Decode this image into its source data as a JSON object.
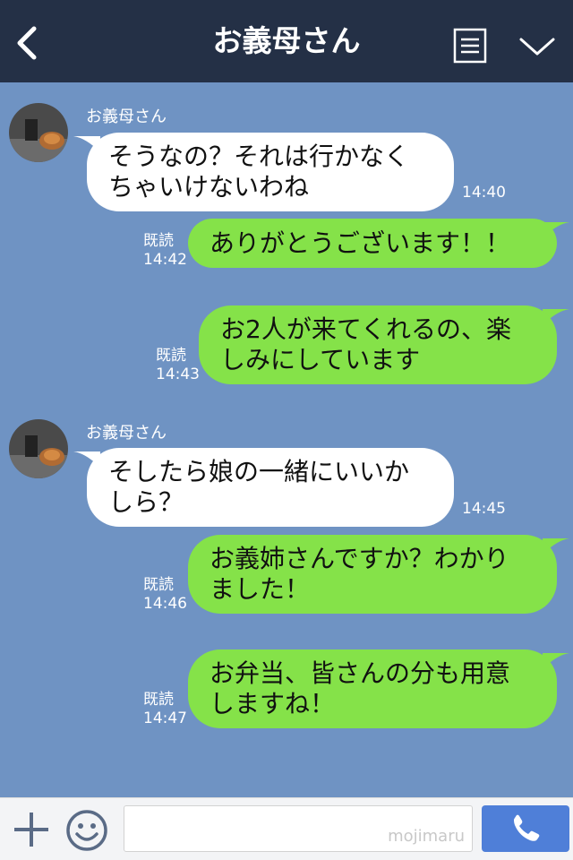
{
  "header": {
    "title": "お義母さん",
    "back_icon": "chevron-left-icon",
    "menu_icon": "menu-icon",
    "collapse_icon": "chevron-down-icon"
  },
  "colors": {
    "header_bg": "#243046",
    "chat_bg": "#6f93c3",
    "incoming_bubble": "#ffffff",
    "outgoing_bubble": "#85e249",
    "call_button": "#4f7fd8"
  },
  "messages": [
    {
      "direction": "in",
      "sender": "お義母さん",
      "lines": [
        "そうなの？それは行かなく",
        "ちゃいけないわね"
      ],
      "time": "14:40"
    },
    {
      "direction": "out",
      "read": "既読",
      "time": "14:42",
      "lines": [
        "ありがとうございます！！"
      ]
    },
    {
      "direction": "out",
      "read": "既読",
      "time": "14:43",
      "lines": [
        "お2人が来てくれるの、楽",
        "しみにしています"
      ]
    },
    {
      "direction": "in",
      "sender": "お義母さん",
      "lines": [
        "そしたら娘の一緒にいいか",
        "しら？"
      ],
      "time": "14:45"
    },
    {
      "direction": "out",
      "read": "既読",
      "time": "14:46",
      "lines": [
        "お義姉さんですか？わかり",
        "ました！"
      ]
    },
    {
      "direction": "out",
      "read": "既読",
      "time": "14:47",
      "lines": [
        "お弁当、皆さんの分も用意",
        "しますね！"
      ]
    }
  ],
  "footer": {
    "plus_icon": "plus-icon",
    "emoji_icon": "smiley-icon",
    "input_value": "",
    "watermark": "mojimaru",
    "call_icon": "phone-icon"
  }
}
